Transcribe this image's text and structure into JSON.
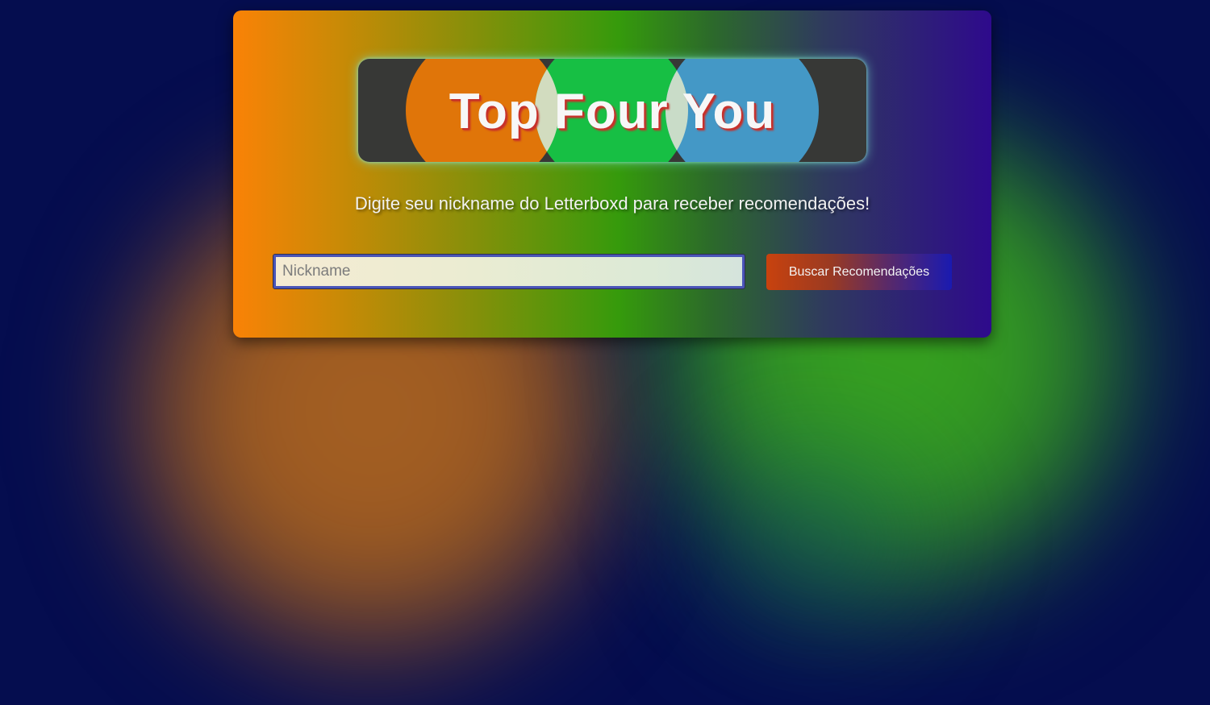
{
  "header": {
    "title": "Top Four You"
  },
  "intro": {
    "text": "Digite seu nickname do Letterboxd para receber recomendações!"
  },
  "search": {
    "placeholder": "Nickname",
    "value": "",
    "button_label": "Buscar Recomendações"
  },
  "colors": {
    "background": "#050d4f",
    "circle_orange": "#e07509",
    "circle_green": "#17bf44",
    "circle_blue": "#4498c6",
    "title_shadow": "#c8312b"
  }
}
